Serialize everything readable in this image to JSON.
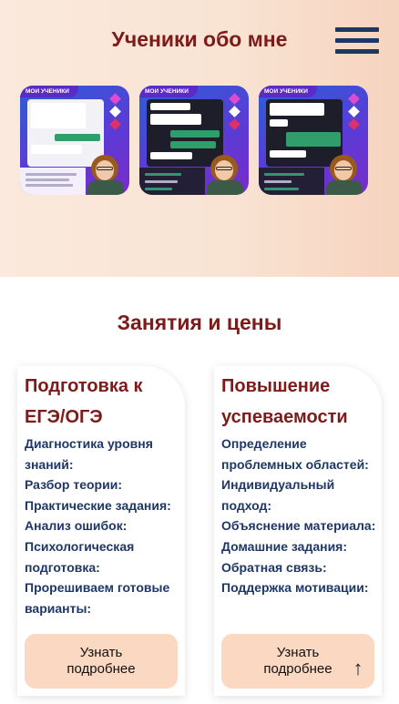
{
  "hero": {
    "title": "Ученики обо мне",
    "menu_icon": "hamburger-menu-icon"
  },
  "reviews": [
    {
      "tag": "МОИ УЧЕНИКИ"
    },
    {
      "tag": "МОИ УЧЕНИКИ"
    },
    {
      "tag": "МОИ УЧЕНИКИ"
    }
  ],
  "pricing": {
    "title": "Занятия и цены",
    "cards": [
      {
        "title": "Подготовка к ЕГЭ/ОГЭ",
        "items": [
          "Диагностика уровня знаний:",
          "Разбор теории:",
          "Практические задания:",
          "Анализ ошибок:",
          "Психологическая подготовка:",
          "Прорешиваем готовые варианты:"
        ],
        "button": "Узнать подробнее"
      },
      {
        "title": "Повышение успеваемости",
        "items": [
          "Определение проблемных областей:",
          "Индивидуальный подход:",
          "Объяснение материала:",
          "Домашние задания:",
          "Обратная связь:",
          "Поддержка мотивации:"
        ],
        "button": "Узнать подробнее"
      }
    ]
  },
  "scroll_top": {
    "icon": "arrow-up-icon",
    "glyph": "↑"
  },
  "colors": {
    "accent": "#7d1a1a",
    "text_blue": "#1e3766",
    "button_bg": "#fbd8c2"
  }
}
